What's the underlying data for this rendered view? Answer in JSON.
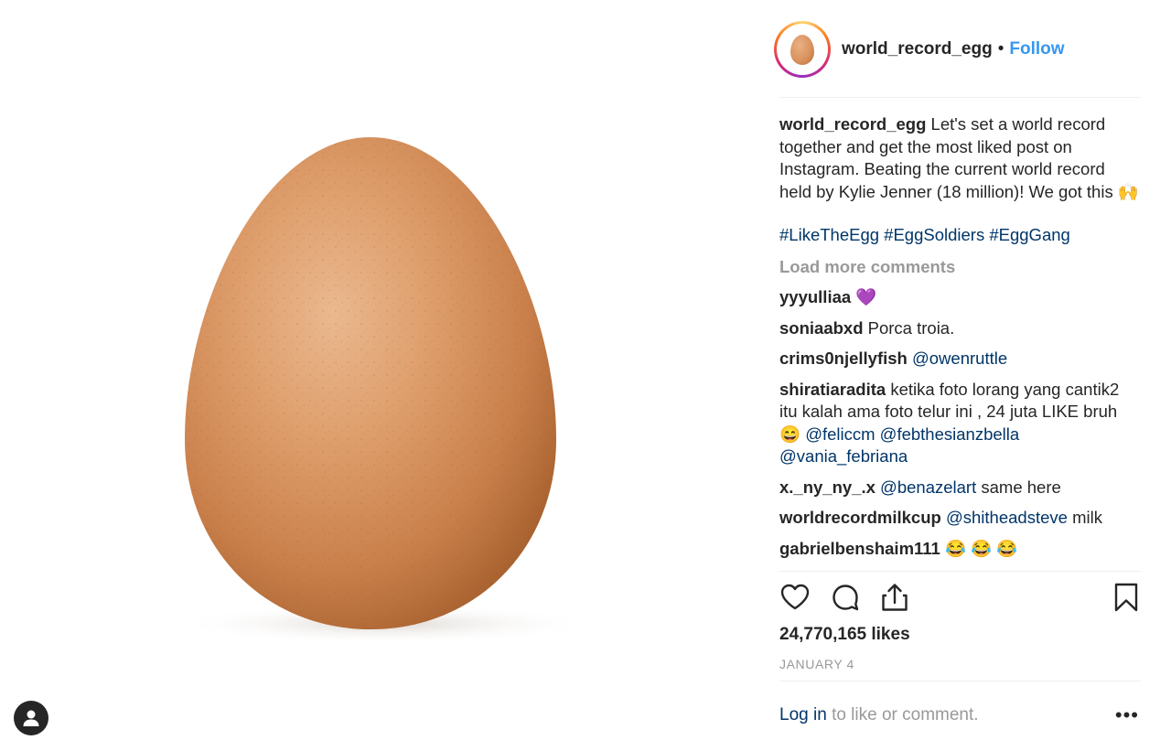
{
  "post": {
    "username": "world_record_egg",
    "separator": "•",
    "follow_label": "Follow",
    "caption_text": "Let's set a world record together and get the most liked post on Instagram. Beating the current world record held by Kylie Jenner (18 million)! We got this 🙌",
    "hashtags": "#LikeTheEgg #EggSoldiers #EggGang",
    "load_more": "Load more comments",
    "likes": "24,770,165 likes",
    "date": "JANUARY 4"
  },
  "comments": [
    {
      "user": "yyyulliaa",
      "text": "💜"
    },
    {
      "user": "soniaabxd",
      "text": "Porca troia."
    },
    {
      "user": "crims0njellyfish",
      "text": "",
      "mention": "@owenruttle",
      "after": ""
    },
    {
      "user": "shiratiaradita",
      "text": "ketika foto lorang yang cantik2 itu kalah ama foto telur ini , 24 juta LIKE bruh 😄 ",
      "mention": "@feliccm @febthesianzbella @vania_febriana",
      "after": ""
    },
    {
      "user": "x._ny_ny_.x",
      "text": "",
      "mention": "@benazelart",
      "after": "same here"
    },
    {
      "user": "worldrecordmilkcup",
      "text": "",
      "mention": "@shitheadsteve",
      "after": "milk"
    },
    {
      "user": "gabrielbenshaim111",
      "text": "😂 😂 😂"
    }
  ],
  "footer": {
    "login_label": "Log in",
    "login_suffix": "to like or comment.",
    "more_label": "•••"
  },
  "icons": {
    "like": "heart-icon",
    "comment": "comment-bubble-icon",
    "share": "share-icon",
    "save": "bookmark-icon",
    "profile": "user-profile-icon"
  },
  "colors": {
    "link": "#003569",
    "follow": "#3897f0",
    "muted": "#999999",
    "text": "#262626"
  }
}
